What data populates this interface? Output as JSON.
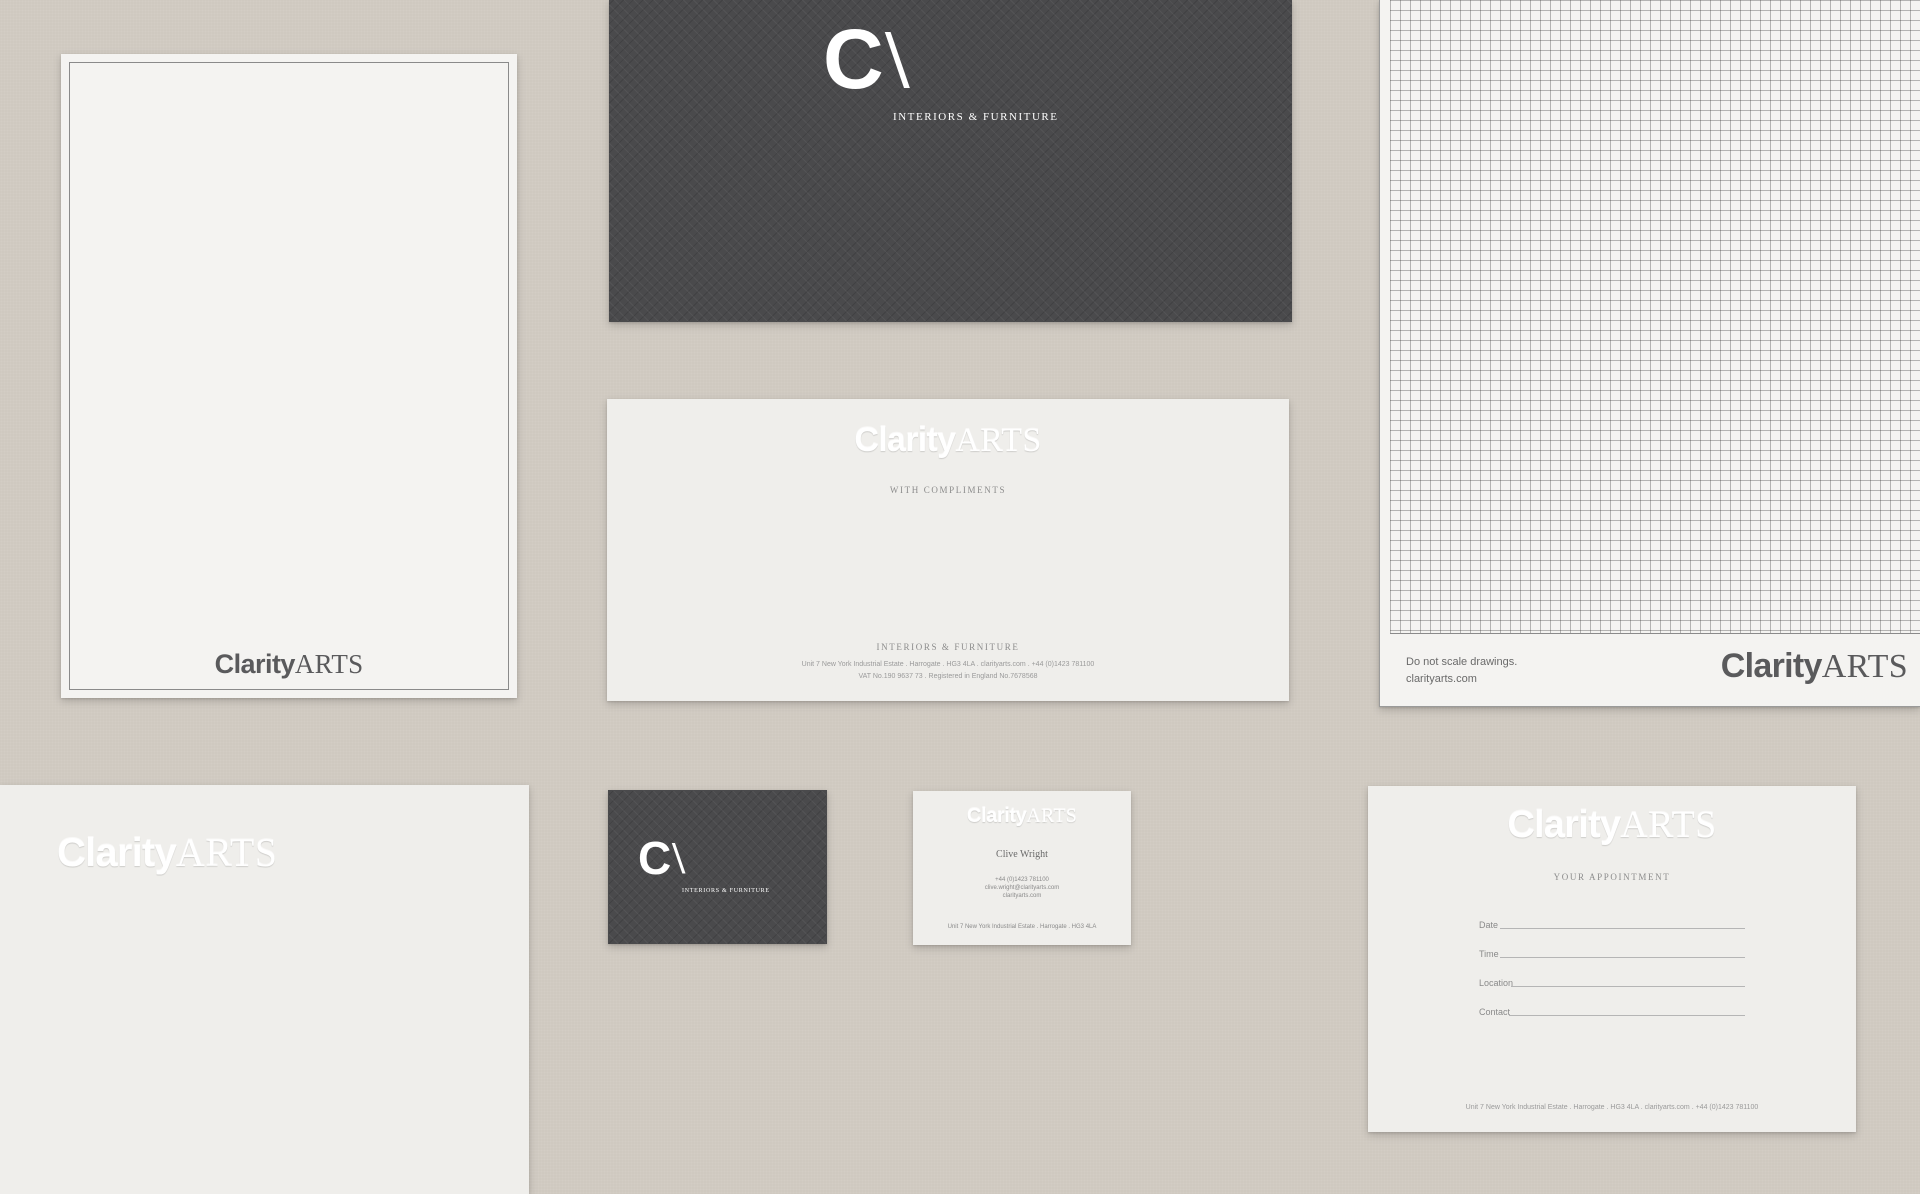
{
  "brand": {
    "wordmark_part1": "Clarity",
    "wordmark_part2": "ARTS",
    "monogram_c": "C",
    "monogram_a": "\\",
    "tagline": "INTERIORS & FURNITURE"
  },
  "comp_slip": {
    "heading": "WITH COMPLIMENTS",
    "footer_tagline": "INTERIORS & FURNITURE",
    "address_line": "Unit 7 New York Industrial Estate . Harrogate . HG3 4LA . clarityarts.com . +44 (0)1423 781100",
    "vat_line": "VAT No.190 9637 73 . Registered in England No.7678568"
  },
  "grid_paper": {
    "note": "Do not scale drawings.",
    "website": "clarityarts.com"
  },
  "business_card_back": {
    "name": "Clive Wright",
    "phone": "+44 (0)1423 781100",
    "email": "clive.wright@clarityarts.com",
    "website": "clarityarts.com",
    "address": "Unit 7 New York Industrial Estate . Harrogate . HG3 4LA"
  },
  "appointment_card": {
    "heading": "YOUR APPOINTMENT",
    "fields": [
      "Date",
      "Time",
      "Location",
      "Contact"
    ],
    "address_line": "Unit 7 New York Industrial Estate . Harrogate . HG3 4LA . clarityarts.com . +44 (0)1423 781100"
  },
  "colors": {
    "background": "#cfc9c0",
    "paper": "#efeeeb",
    "dark_card": "#4a4a4c",
    "ink": "#5a5a5c"
  }
}
